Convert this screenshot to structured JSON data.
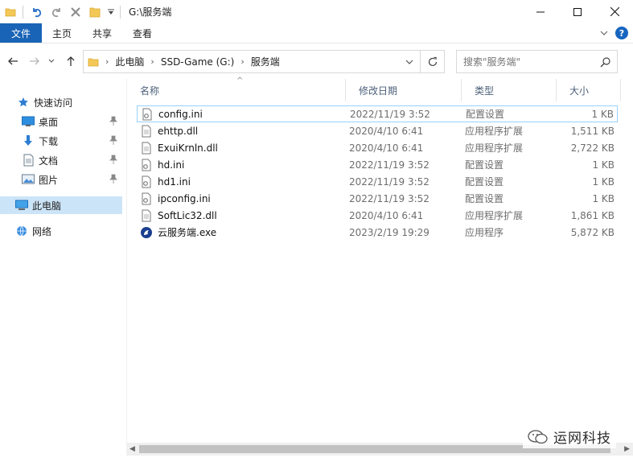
{
  "window": {
    "title": "G:\\服务端",
    "controls": {
      "minimize": "minimize-icon",
      "maximize": "maximize-icon",
      "close": "close-icon"
    }
  },
  "ribbon": {
    "tabs": [
      "文件",
      "主页",
      "共享",
      "查看"
    ],
    "help": "?"
  },
  "address": {
    "crumbs": [
      "此电脑",
      "SSD-Game (G:)",
      "服务端"
    ]
  },
  "search": {
    "placeholder": "搜索\"服务端\""
  },
  "nav": {
    "quick_access": "快速访问",
    "items": [
      {
        "label": "桌面",
        "icon": "desktop-icon",
        "pinned": true
      },
      {
        "label": "下载",
        "icon": "download-icon",
        "pinned": true
      },
      {
        "label": "文档",
        "icon": "documents-icon",
        "pinned": true
      },
      {
        "label": "图片",
        "icon": "pictures-icon",
        "pinned": true
      }
    ],
    "this_pc": "此电脑",
    "network": "网络"
  },
  "columns": {
    "name": "名称",
    "date": "修改日期",
    "type": "类型",
    "size": "大小"
  },
  "files": [
    {
      "name": "config.ini",
      "date": "2022/11/19 3:52",
      "type": "配置设置",
      "size": "1 KB",
      "icon": "ini-file-icon"
    },
    {
      "name": "ehttp.dll",
      "date": "2020/4/10 6:41",
      "type": "应用程序扩展",
      "size": "1,511 KB",
      "icon": "dll-file-icon"
    },
    {
      "name": "ExuiKrnln.dll",
      "date": "2020/4/10 6:41",
      "type": "应用程序扩展",
      "size": "2,722 KB",
      "icon": "dll-file-icon"
    },
    {
      "name": "hd.ini",
      "date": "2022/11/19 3:52",
      "type": "配置设置",
      "size": "1 KB",
      "icon": "ini-file-icon"
    },
    {
      "name": "hd1.ini",
      "date": "2022/11/19 3:52",
      "type": "配置设置",
      "size": "1 KB",
      "icon": "ini-file-icon"
    },
    {
      "name": "ipconfig.ini",
      "date": "2022/11/19 3:52",
      "type": "配置设置",
      "size": "1 KB",
      "icon": "ini-file-icon"
    },
    {
      "name": "SoftLic32.dll",
      "date": "2020/4/10 6:41",
      "type": "应用程序扩展",
      "size": "1,861 KB",
      "icon": "dll-file-icon"
    },
    {
      "name": "云服务端.exe",
      "date": "2023/2/19 19:29",
      "type": "应用程序",
      "size": "5,872 KB",
      "icon": "exe-app-icon"
    }
  ],
  "watermark": "运网科技",
  "colors": {
    "file_tab": "#1a64b7",
    "selected_nav": "#cce4f7",
    "focus_border": "#99d1ff",
    "header_text": "#4c607a"
  }
}
